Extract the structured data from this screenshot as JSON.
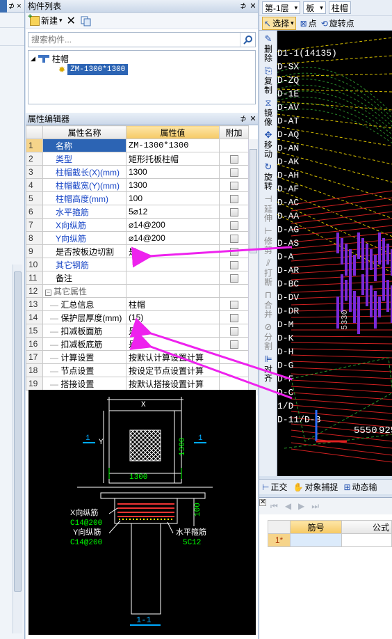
{
  "left_strip": {
    "pin_label": "⊅ ×"
  },
  "component_list": {
    "title": "构件列表",
    "new_button": "新建",
    "search_placeholder": "搜索构件...",
    "tree_root": "柱帽",
    "tree_child": "ZM-1300*1300"
  },
  "attr_editor": {
    "title": "属性编辑器",
    "headers": {
      "name": "属性名称",
      "value": "属性值",
      "extra": "附加"
    },
    "rows": [
      {
        "no": "1",
        "name": "名称",
        "value": "ZM-1300*1300",
        "blue": true
      },
      {
        "no": "2",
        "name": "类型",
        "value": "矩形托板柱帽",
        "blue": true
      },
      {
        "no": "3",
        "name": "柱帽截长(X)(mm)",
        "value": "1300",
        "blue": true
      },
      {
        "no": "4",
        "name": "柱帽截宽(Y)(mm)",
        "value": "1300",
        "blue": true
      },
      {
        "no": "5",
        "name": "柱帽高度(mm)",
        "value": "100",
        "blue": true
      },
      {
        "no": "6",
        "name": "水平箍筋",
        "value": "5⌀12",
        "blue": true
      },
      {
        "no": "7",
        "name": "X向纵筋",
        "value": "⌀14@200",
        "blue": true
      },
      {
        "no": "8",
        "name": "Y向纵筋",
        "value": "⌀14@200",
        "blue": true
      },
      {
        "no": "9",
        "name": "是否按板边切割",
        "value": "是",
        "blue": false
      },
      {
        "no": "10",
        "name": "其它钢筋",
        "value": "",
        "blue": true
      },
      {
        "no": "11",
        "name": "备注",
        "value": "",
        "blue": false
      },
      {
        "no": "12",
        "name": "其它属性",
        "value": "",
        "blue": false
      },
      {
        "no": "13",
        "name": "汇总信息",
        "value": "柱帽",
        "blue": false
      },
      {
        "no": "14",
        "name": "保护层厚度(mm)",
        "value": "(15)",
        "blue": false
      },
      {
        "no": "15",
        "name": "扣减板面筋",
        "value": "是",
        "blue": false
      },
      {
        "no": "16",
        "name": "扣减板底筋",
        "value": "是",
        "blue": false
      },
      {
        "no": "17",
        "name": "计算设置",
        "value": "按默认计算设置计算",
        "blue": false
      },
      {
        "no": "18",
        "name": "节点设置",
        "value": "按设定节点设置计算",
        "blue": false
      },
      {
        "no": "19",
        "name": "搭接设置",
        "value": "按默认搭接设置计算",
        "blue": false
      }
    ]
  },
  "preview": {
    "x_label": "X",
    "y_label": "Y",
    "dim_1300_h": "1300",
    "dim_1300_v": "1300",
    "section_mark": "1",
    "height_100": "100",
    "x_rebar": "X向纵筋",
    "x_rebar_spec": "C14@200",
    "y_rebar": "Y向纵筋",
    "y_rebar_spec": "C14@200",
    "stirrup": "水平箍筋",
    "stirrup_spec": "5C12",
    "section_title": "1-1"
  },
  "right_panel": {
    "floor": "第-1层",
    "category": "板",
    "component": "柱帽",
    "select": "选择",
    "point": "点",
    "rotate_point": "旋转点",
    "vtools": [
      {
        "label": "删除",
        "icon": "✎",
        "disabled": false
      },
      {
        "label": "复制",
        "icon": "⎘",
        "disabled": false
      },
      {
        "label": "镜像",
        "icon": "⧖",
        "disabled": false
      },
      {
        "label": "移动",
        "icon": "✥",
        "disabled": false
      },
      {
        "label": "旋转",
        "icon": "↻",
        "disabled": false
      },
      {
        "label": "延伸",
        "icon": "⊣",
        "disabled": true
      },
      {
        "label": "修剪",
        "icon": "⊢",
        "disabled": true
      },
      {
        "label": "打断",
        "icon": "⫽",
        "disabled": true
      },
      {
        "label": "合并",
        "icon": "⊓",
        "disabled": true
      },
      {
        "label": "分割",
        "icon": "⊘",
        "disabled": true
      },
      {
        "label": "对齐",
        "icon": "⊫",
        "disabled": false
      }
    ],
    "snap": {
      "ortho": "正交",
      "snap": "对象捕捉",
      "dynamic": "动态输"
    },
    "grid": {
      "col1": "筋号",
      "col2": "公式",
      "row1": "1*"
    },
    "cad_labels": [
      "D1-1(14135)",
      "D-SX",
      "D-ZQ",
      "D-1E",
      "D-AV",
      "D-AT",
      "D-AQ",
      "D-AN",
      "D-AK",
      "D-AH",
      "D-AF",
      "D-AC",
      "D-AA",
      "D-AG",
      "D-AS",
      "D-A",
      "D-AR",
      "D-BC",
      "D-DV",
      "D-DR",
      "D-M",
      "D-K",
      "D-H",
      "D-G",
      "D-F",
      "D-C",
      "1/D",
      "D-11/D-B"
    ],
    "cad_numbers": {
      "n1": "5550",
      "n2": "925",
      "n3": "5330"
    }
  }
}
